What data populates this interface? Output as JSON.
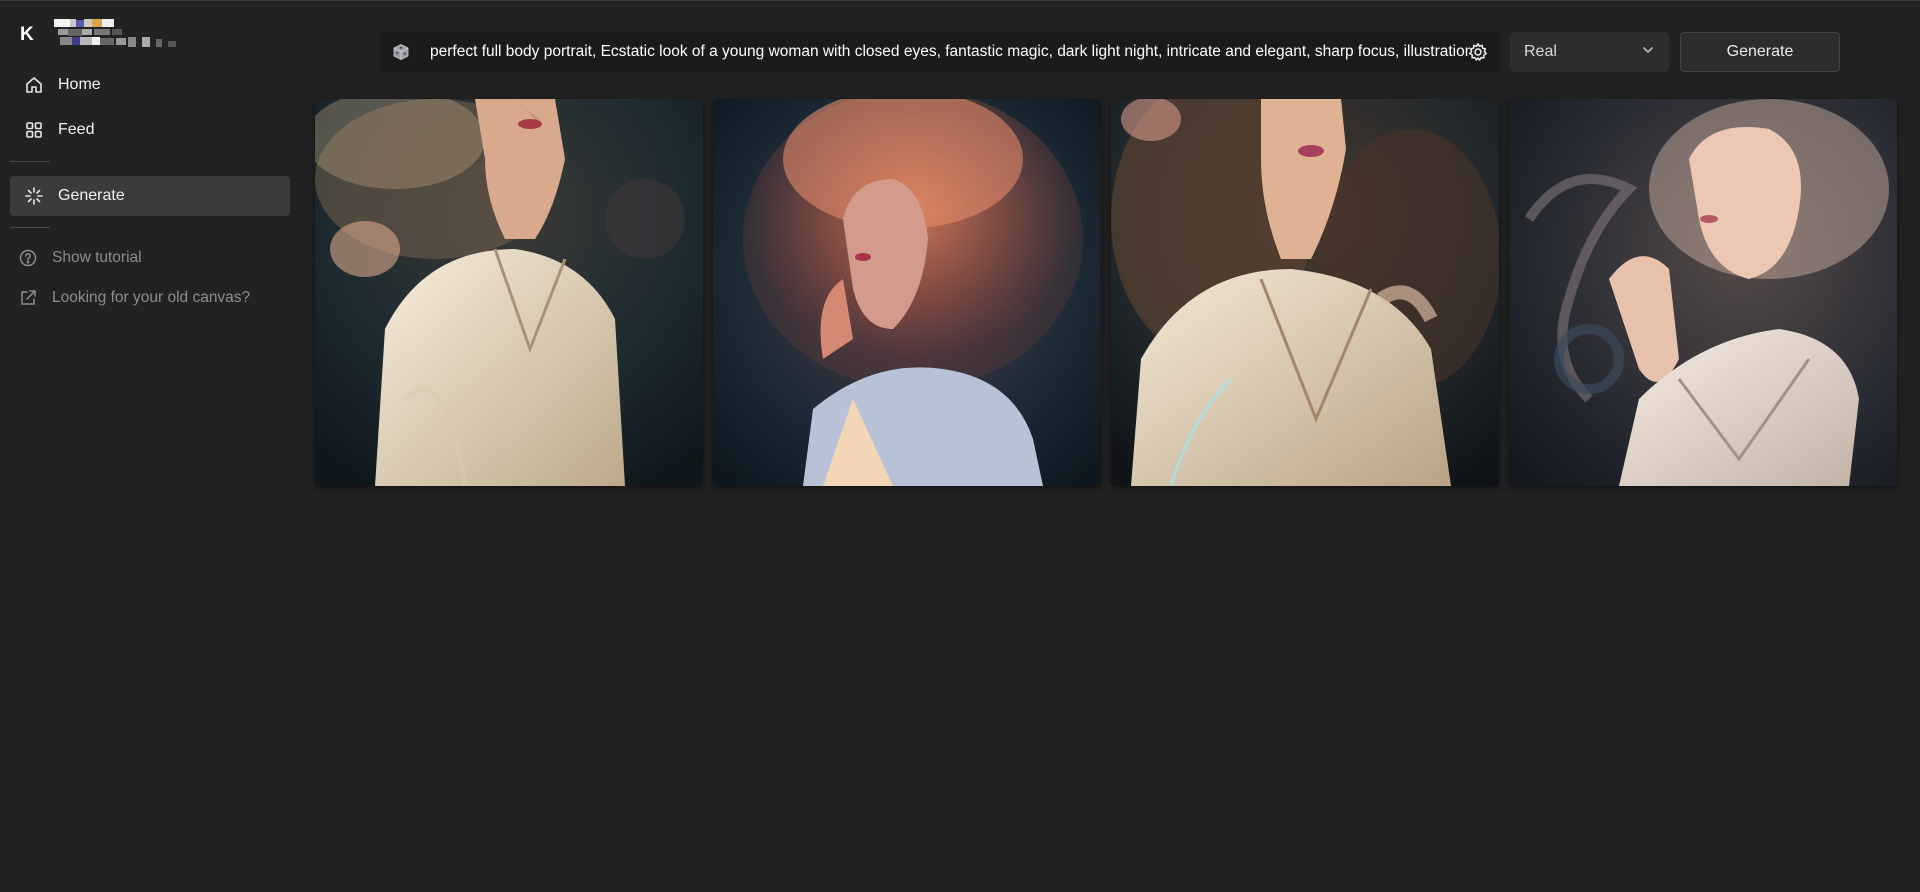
{
  "brand": {
    "letter": "K"
  },
  "nav": {
    "home": "Home",
    "feed": "Feed",
    "generate": "Generate",
    "show_tutorial": "Show tutorial",
    "old_canvas": "Looking for your old canvas?"
  },
  "prompt": {
    "text": "perfect full body portrait, Ecstatic look of a young woman with closed eyes, fantastic magic, dark light night, intricate and elegant, sharp focus, illustration"
  },
  "style_select": {
    "value": "Real"
  },
  "generate_button": {
    "label": "Generate"
  },
  "icons": [
    "home-icon",
    "feed-icon",
    "generate-icon",
    "help-icon",
    "external-link-icon",
    "dice-icon",
    "settings-icon",
    "chevron-down-icon"
  ]
}
